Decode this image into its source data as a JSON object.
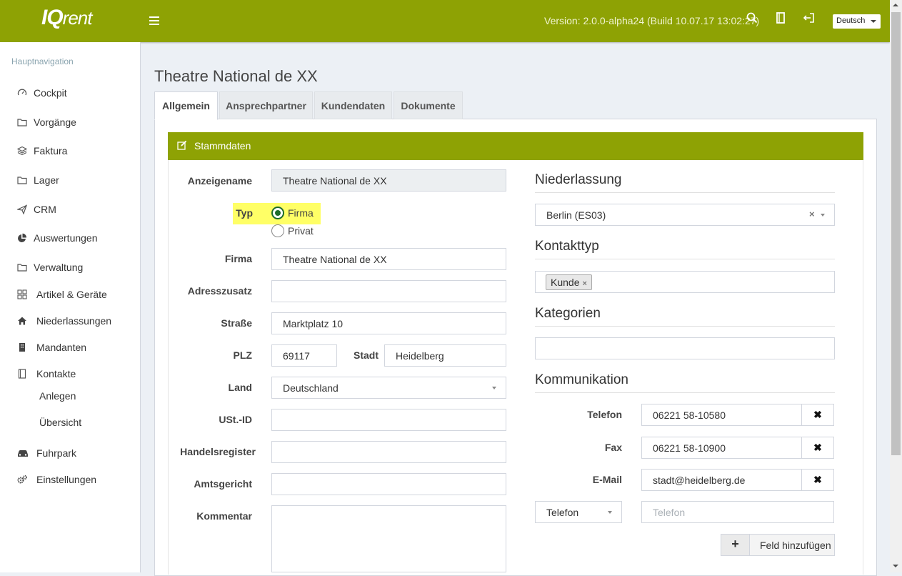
{
  "header": {
    "logo_main": "IQ",
    "logo_sub": "rent",
    "version": "Version: 2.0.0-alpha24 (Build 10.07.17 13:02:27)",
    "language": "Deutsch"
  },
  "sidebar": {
    "header": "Hauptnavigation",
    "items": [
      {
        "label": "Cockpit",
        "icon": "dashboard-icon"
      },
      {
        "label": "Vorgänge",
        "icon": "folder-icon"
      },
      {
        "label": "Faktura",
        "icon": "layers-icon"
      },
      {
        "label": "Lager",
        "icon": "folder-icon"
      },
      {
        "label": "CRM",
        "icon": "paper-plane-icon"
      },
      {
        "label": "Auswertungen",
        "icon": "pie-chart-icon"
      },
      {
        "label": "Verwaltung",
        "icon": "folder-icon"
      },
      {
        "label": "Artikel & Geräte",
        "icon": "grid-icon"
      },
      {
        "label": "Niederlassungen",
        "icon": "home-icon"
      },
      {
        "label": "Mandanten",
        "icon": "building-icon"
      },
      {
        "label": "Kontakte",
        "icon": "address-book-icon"
      },
      {
        "label": "Fuhrpark",
        "icon": "car-icon"
      },
      {
        "label": "Einstellungen",
        "icon": "gears-icon"
      }
    ],
    "subitems": [
      "Anlegen",
      "Übersicht"
    ]
  },
  "page": {
    "title": "Theatre National de XX",
    "tabs": [
      "Allgemein",
      "Ansprechpartner",
      "Kundendaten",
      "Dokumente"
    ],
    "box_title": "Stammdaten"
  },
  "form": {
    "anzeigename_label": "Anzeigename",
    "anzeigename": "Theatre National de XX",
    "typ_label": "Typ",
    "typ_options": [
      "Firma",
      "Privat"
    ],
    "typ_selected": "Firma",
    "firma_label": "Firma",
    "firma": "Theatre National de XX",
    "adresszusatz_label": "Adresszusatz",
    "adresszusatz": "",
    "strasse_label": "Straße",
    "strasse": "Marktplatz 10",
    "plz_label": "PLZ",
    "plz": "69117",
    "stadt_label": "Stadt",
    "stadt": "Heidelberg",
    "land_label": "Land",
    "land": "Deutschland",
    "ustid_label": "USt.-ID",
    "ustid": "",
    "handelsregister_label": "Handelsregister",
    "handelsregister": "",
    "amtsgericht_label": "Amtsgericht",
    "amtsgericht": "",
    "kommentar_label": "Kommentar",
    "kommentar": ""
  },
  "right": {
    "niederlassung_title": "Niederlassung",
    "niederlassung": "Berlin (ES03)",
    "kontakttyp_title": "Kontakttyp",
    "kontakttyp_tag": "Kunde",
    "kategorien_title": "Kategorien",
    "kommunikation_title": "Kommunikation",
    "comm": [
      {
        "label": "Telefon",
        "value": "06221 58-10580"
      },
      {
        "label": "Fax",
        "value": "06221 58-10900"
      },
      {
        "label": "E-Mail",
        "value": "stadt@heidelberg.de"
      }
    ],
    "new_type": "Telefon",
    "new_placeholder": "Telefon",
    "add_button": "Feld hinzufügen",
    "remove_symbol": "✖",
    "tag_remove": "×",
    "plus_symbol": "+"
  },
  "colors": {
    "brand": "#8ea204",
    "highlight": "#ffff66"
  }
}
